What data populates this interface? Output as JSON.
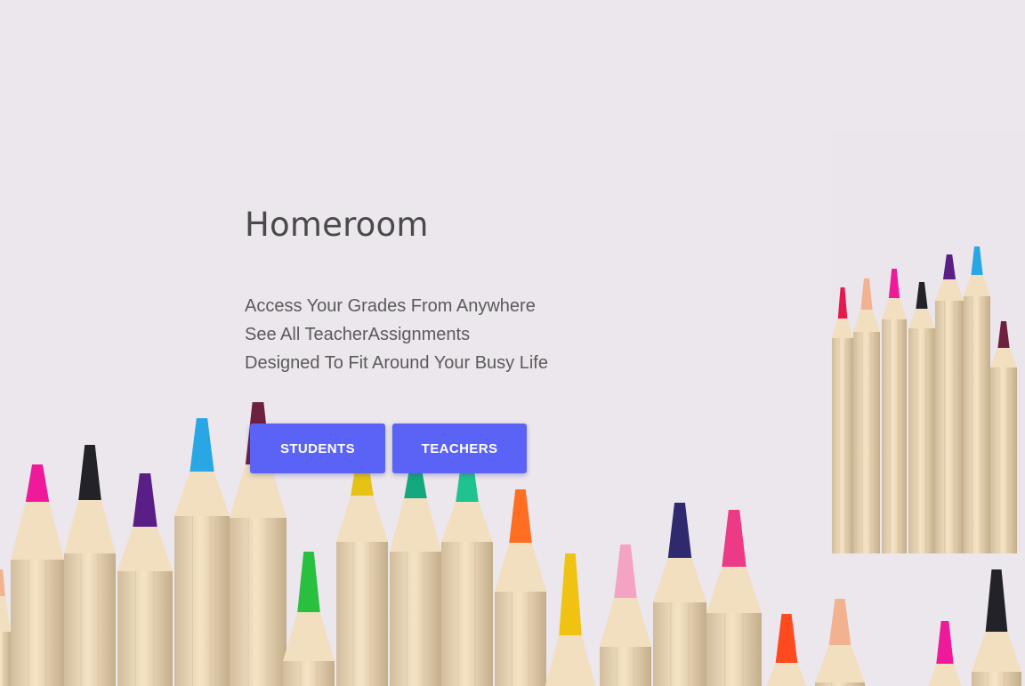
{
  "hero": {
    "title": "Homeroom",
    "features": [
      "Access Your Grades From Anywhere",
      "See All TeacherAssignments",
      "Designed To Fit Around Your Busy Life"
    ]
  },
  "actions": {
    "students_label": "STUDENTS",
    "teachers_label": "TEACHERS"
  },
  "colors": {
    "background": "#ece6ed",
    "button": "#5a63f5",
    "title_text": "#4a4a4a",
    "body_text": "#5b5b5b"
  },
  "pencil_tip_colors": [
    "#f3b28f",
    "#ef1a9a",
    "#222228",
    "#5a1f86",
    "#29a7e4",
    "#6e2040",
    "#29c03f",
    "#e6c216",
    "#13a87d",
    "#1fc290",
    "#ff6e21",
    "#f0c312",
    "#f4a3c3",
    "#2f2a6e",
    "#ec3a86",
    "#ff4a1f"
  ]
}
